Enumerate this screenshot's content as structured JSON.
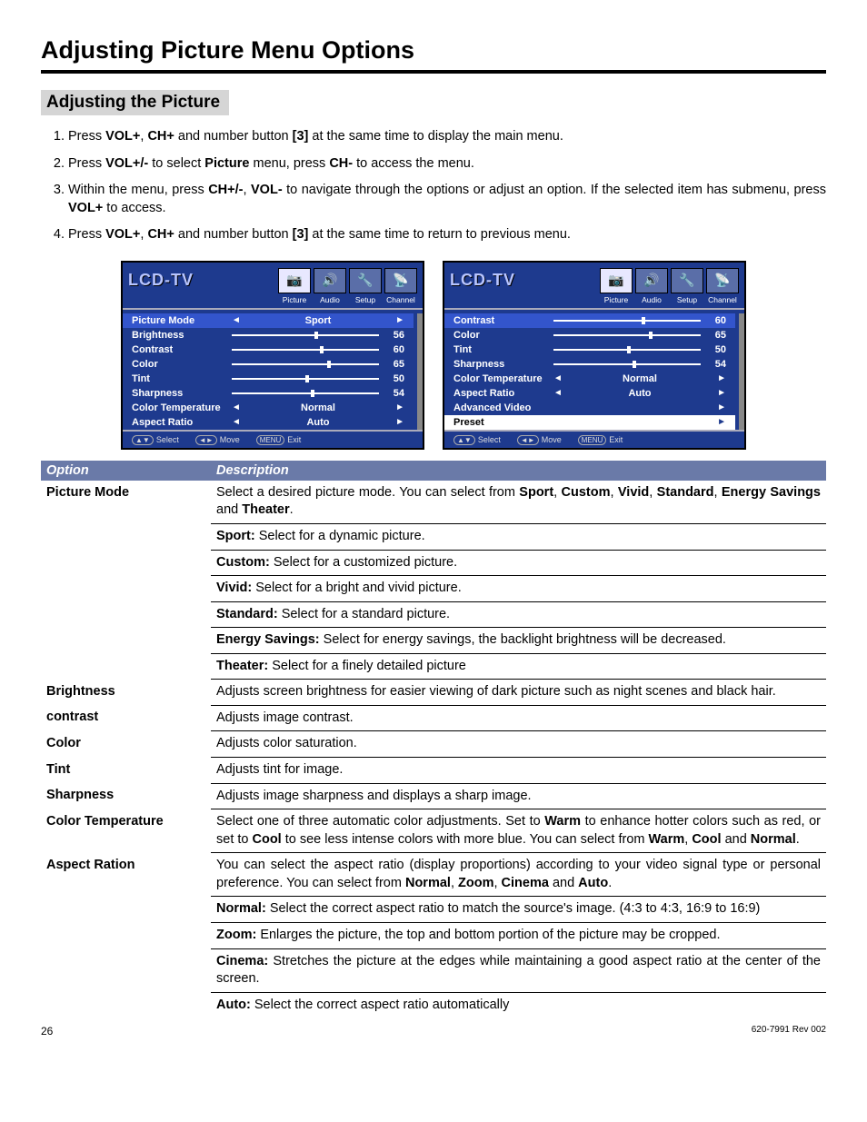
{
  "title": "Adjusting Picture Menu Options",
  "section": "Adjusting the Picture",
  "steps": {
    "s1a": "Press ",
    "s1b": "VOL+",
    "s1c": ", ",
    "s1d": "CH+",
    "s1e": " and number button ",
    "s1f": "[3]",
    "s1g": " at the same time to display the main menu.",
    "s2a": "Press ",
    "s2b": "VOL+/-",
    "s2c": " to select ",
    "s2d": "Picture",
    "s2e": " menu, press ",
    "s2f": "CH-",
    "s2g": " to access the menu.",
    "s3a": "Within the menu, press ",
    "s3b": "CH+/-",
    "s3c": ", ",
    "s3d": "VOL-",
    "s3e": " to navigate through the options or adjust an option. If the selected item has submenu, press ",
    "s3f": "VOL+",
    "s3g": " to access.",
    "s4a": "Press ",
    "s4b": "VOL+",
    "s4c": ", ",
    "s4d": "CH+",
    "s4e": " and number button ",
    "s4f": "[3]",
    "s4g": " at the same time to return to previous menu."
  },
  "osd": {
    "logo": "LCD-TV",
    "tabs": [
      "Picture",
      "Audio",
      "Setup",
      "Channel"
    ],
    "left": {
      "pm_label": "Picture Mode",
      "pm_val": "Sport",
      "br_label": "Brightness",
      "br_val": "56",
      "co_label": "Contrast",
      "co_val": "60",
      "cl_label": "Color",
      "cl_val": "65",
      "ti_label": "Tint",
      "ti_val": "50",
      "sh_label": "Sharpness",
      "sh_val": "54",
      "ct_label": "Color Temperature",
      "ct_val": "Normal",
      "ar_label": "Aspect Ratio",
      "ar_val": "Auto"
    },
    "right": {
      "co_label": "Contrast",
      "co_val": "60",
      "cl_label": "Color",
      "cl_val": "65",
      "ti_label": "Tint",
      "ti_val": "50",
      "sh_label": "Sharpness",
      "sh_val": "54",
      "ct_label": "Color Temperature",
      "ct_val": "Normal",
      "ar_label": "Aspect Ratio",
      "ar_val": "Auto",
      "av_label": "Advanced Video",
      "pr_label": "Preset"
    },
    "foot": {
      "sel": "Select",
      "mov": "Move",
      "menu": "MENU",
      "exit": "Exit"
    }
  },
  "table": {
    "h1": "Option",
    "h2": "Description",
    "r1_opt": "Picture Mode",
    "r1_a": "Select a desired picture mode. You can select from ",
    "r1_b": "Sport",
    "r1_c": ", ",
    "r1_d": "Custom",
    "r1_e": ", ",
    "r1_f": "Vivid",
    "r1_g": ", ",
    "r1_h": "Standard",
    "r1_i": ", ",
    "r1_j": "Energy Savings",
    "r1_k": " and ",
    "r1_l": "Theater",
    "r1_m": ".",
    "r1s1a": "Sport:",
    "r1s1b": " Select for a dynamic picture.",
    "r1s2a": "Custom:",
    "r1s2b": " Select for a customized picture.",
    "r1s3a": "Vivid:",
    "r1s3b": " Select for a bright and vivid picture.",
    "r1s4a": "Standard:",
    "r1s4b": " Select for a standard picture.",
    "r1s5a": "Energy Savings:",
    "r1s5b": " Select for energy savings, the backlight brightness will be decreased.",
    "r1s6a": "Theater:",
    "r1s6b": " Select for a finely detailed picture",
    "r2_opt": "Brightness",
    "r2_d": "Adjusts screen brightness for easier viewing of dark picture such as night scenes and black hair.",
    "r3_opt": "contrast",
    "r3_d": "Adjusts image contrast.",
    "r4_opt": "Color",
    "r4_d": "Adjusts color saturation.",
    "r5_opt": "Tint",
    "r5_d": "Adjusts tint for image.",
    "r6_opt": "Sharpness",
    "r6_d": "Adjusts image sharpness and displays a sharp image.",
    "r7_opt": "Color Temperature",
    "r7_a": "Select one of three automatic color adjustments. Set to ",
    "r7_b": "Warm",
    "r7_c": " to enhance hotter colors such as red, or set to ",
    "r7_d": "Cool",
    "r7_e": " to see less intense colors with more blue. You can select from ",
    "r7_f": "Warm",
    "r7_g": ", ",
    "r7_h": "Cool",
    "r7_i": " and ",
    "r7_j": "Normal",
    "r7_k": ".",
    "r8_opt": "Aspect Ration",
    "r8_a": "You can select the aspect ratio (display proportions) according to your video signal type or personal preference. You can select from ",
    "r8_b": "Normal",
    "r8_c": ", ",
    "r8_d": "Zoom",
    "r8_e": ", ",
    "r8_f": "Cinema",
    "r8_g": " and ",
    "r8_h": "Auto",
    "r8_i": ".",
    "r8s1a": "Normal:",
    "r8s1b": " Select the correct aspect ratio to match the source's image. (4:3 to 4:3, 16:9 to 16:9)",
    "r8s2a": "Zoom:",
    "r8s2b": " Enlarges the picture, the top and bottom portion of the picture may be cropped.",
    "r8s3a": "Cinema:",
    "r8s3b": " Stretches the picture at the edges while maintaining a good aspect ratio at the center of the screen.",
    "r8s4a": "Auto:",
    "r8s4b": " Select the correct aspect ratio automatically"
  },
  "footer": {
    "page": "26",
    "rev": "620-7991 Rev 002"
  }
}
